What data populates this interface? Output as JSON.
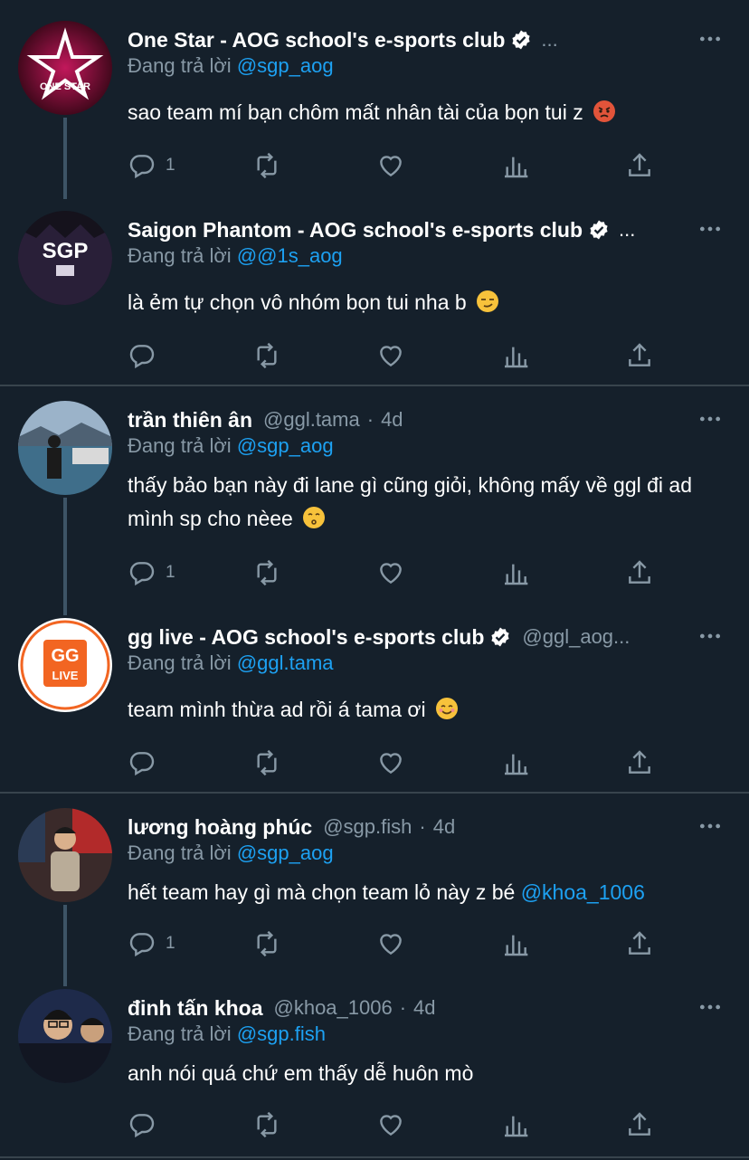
{
  "reply_prefix": "Đang trả lời",
  "tweets": [
    {
      "display_name": "One Star - AOG school's e-sports club",
      "verified": true,
      "handle": "",
      "time": "",
      "truncated": true,
      "reply_to": "@sgp_aog",
      "text": "sao team mí bạn chôm mất nhân tài của bọn tui z",
      "emoji": "angry-face",
      "reply_count": "1",
      "avatar_text": "ONE STAR"
    },
    {
      "display_name": "Saigon Phantom - AOG school's e-sports club",
      "verified": true,
      "handle": "",
      "time": "",
      "truncated": true,
      "reply_to": "@@1s_aog",
      "text": "là ẻm tự chọn vô nhóm bọn tui nha b",
      "emoji": "smirking-face",
      "reply_count": "",
      "avatar_text": "SGP"
    },
    {
      "display_name": "trần thiên ân",
      "verified": false,
      "handle": "@ggl.tama",
      "time": "4d",
      "truncated": false,
      "reply_to": "@sgp_aog",
      "text": "thấy bảo bạn này đi lane gì cũng giỏi, không mấy về ggl đi ad mình sp cho nèee",
      "emoji": "kissing-face",
      "reply_count": "1",
      "avatar_text": ""
    },
    {
      "display_name": "gg live - AOG school's e-sports club",
      "verified": true,
      "handle": "@ggl_aog...",
      "time": "",
      "truncated": false,
      "reply_to": "@ggl.tama",
      "text": "team mình thừa ad rồi á tama ơi",
      "emoji": "smiling-face",
      "reply_count": "",
      "avatar_text": "LIVE"
    },
    {
      "display_name": "lương hoàng phúc",
      "verified": false,
      "handle": "@sgp.fish",
      "time": "4d",
      "truncated": false,
      "reply_to": "@sgp_aog",
      "text": "hết team hay gì mà chọn team lỏ này z bé",
      "mention_in_text": "@khoa_1006",
      "emoji": "",
      "reply_count": "1",
      "avatar_text": ""
    },
    {
      "display_name": "đinh tấn khoa",
      "verified": false,
      "handle": "@khoa_1006",
      "time": "4d",
      "truncated": false,
      "reply_to": "@sgp.fish",
      "text": "anh nói quá chứ em thấy dễ huôn mò",
      "emoji": "",
      "reply_count": "",
      "avatar_text": ""
    }
  ],
  "colors": {
    "background": "#15202b",
    "secondary_text": "#8899a6",
    "accent": "#1da1f2",
    "thread_line": "#3d5466",
    "divider": "#38444d"
  },
  "icons": [
    "reply-icon",
    "retweet-icon",
    "like-icon",
    "analytics-icon",
    "share-icon",
    "more-icon",
    "verified-badge-icon"
  ]
}
